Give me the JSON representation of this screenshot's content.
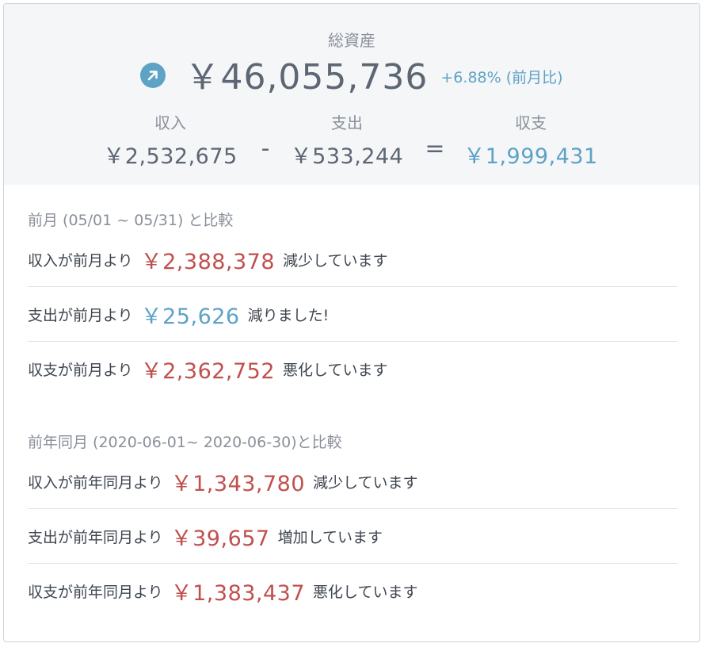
{
  "summary": {
    "total_label": "総資産",
    "trend_icon": "arrow-up-right-icon",
    "total_value": "￥46,055,736",
    "total_change": "+6.88% (前月比)",
    "income_label": "収入",
    "income_value": "￥2,532,675",
    "minus_op": "-",
    "expense_label": "支出",
    "expense_value": "￥533,244",
    "equals_op": "=",
    "balance_label": "収支",
    "balance_value": "￥1,999,431"
  },
  "prev_month": {
    "title": "前月 (05/01 ~ 05/31) と比較",
    "rows": [
      {
        "prefix": "収入が前月より",
        "amount": "￥2,388,378",
        "suffix": "減少しています",
        "tone": "bad"
      },
      {
        "prefix": "支出が前月より",
        "amount": "￥25,626",
        "suffix": "減りました!",
        "tone": "good"
      },
      {
        "prefix": "収支が前月より",
        "amount": "￥2,362,752",
        "suffix": "悪化しています",
        "tone": "bad"
      }
    ]
  },
  "prev_year": {
    "title": "前年同月 (2020-06-01~ 2020-06-30)と比較",
    "rows": [
      {
        "prefix": "収入が前年同月より",
        "amount": "￥1,343,780",
        "suffix": "減少しています",
        "tone": "bad"
      },
      {
        "prefix": "支出が前年同月より",
        "amount": "￥39,657",
        "suffix": "増加しています",
        "tone": "bad"
      },
      {
        "prefix": "収支が前年同月より",
        "amount": "￥1,383,437",
        "suffix": "悪化しています",
        "tone": "bad"
      }
    ]
  },
  "colors": {
    "positive": "#5ea2c6",
    "negative": "#c0504d",
    "text": "#3f4650",
    "muted": "#8a909a"
  }
}
